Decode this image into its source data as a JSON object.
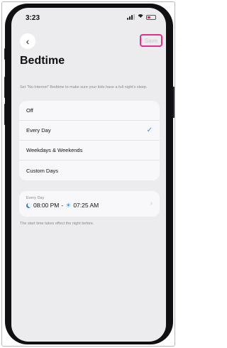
{
  "status_bar": {
    "time": "3:23"
  },
  "header": {
    "back_icon": "chevron-left-icon",
    "save_label": "Save",
    "title": "Bedtime"
  },
  "description": "Set \"No Internet\" Bedtime to make sure your kids have a full night's sleep.",
  "options": [
    {
      "label": "Off",
      "selected": false
    },
    {
      "label": "Every Day",
      "selected": true
    },
    {
      "label": "Weekdays & Weekends",
      "selected": false
    },
    {
      "label": "Custom Days",
      "selected": false
    }
  ],
  "schedule": {
    "label": "Every Day",
    "start": "08:00 PM",
    "separator": "-",
    "end": "07:25 AM"
  },
  "footer_note": "The start time takes effect the night before.",
  "colors": {
    "accent": "#3b8fd9",
    "highlight": "#e0308a",
    "screen_bg": "#ececef",
    "card_bg": "#f8f8fa"
  }
}
